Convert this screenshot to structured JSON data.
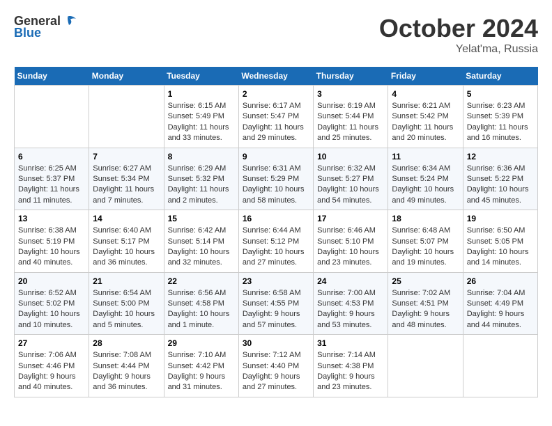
{
  "logo": {
    "general": "General",
    "blue": "Blue"
  },
  "header": {
    "month": "October 2024",
    "location": "Yelat'ma, Russia"
  },
  "weekdays": [
    "Sunday",
    "Monday",
    "Tuesday",
    "Wednesday",
    "Thursday",
    "Friday",
    "Saturday"
  ],
  "weeks": [
    [
      {
        "day": "",
        "info": ""
      },
      {
        "day": "",
        "info": ""
      },
      {
        "day": "1",
        "info": "Sunrise: 6:15 AM\nSunset: 5:49 PM\nDaylight: 11 hours and 33 minutes."
      },
      {
        "day": "2",
        "info": "Sunrise: 6:17 AM\nSunset: 5:47 PM\nDaylight: 11 hours and 29 minutes."
      },
      {
        "day": "3",
        "info": "Sunrise: 6:19 AM\nSunset: 5:44 PM\nDaylight: 11 hours and 25 minutes."
      },
      {
        "day": "4",
        "info": "Sunrise: 6:21 AM\nSunset: 5:42 PM\nDaylight: 11 hours and 20 minutes."
      },
      {
        "day": "5",
        "info": "Sunrise: 6:23 AM\nSunset: 5:39 PM\nDaylight: 11 hours and 16 minutes."
      }
    ],
    [
      {
        "day": "6",
        "info": "Sunrise: 6:25 AM\nSunset: 5:37 PM\nDaylight: 11 hours and 11 minutes."
      },
      {
        "day": "7",
        "info": "Sunrise: 6:27 AM\nSunset: 5:34 PM\nDaylight: 11 hours and 7 minutes."
      },
      {
        "day": "8",
        "info": "Sunrise: 6:29 AM\nSunset: 5:32 PM\nDaylight: 11 hours and 2 minutes."
      },
      {
        "day": "9",
        "info": "Sunrise: 6:31 AM\nSunset: 5:29 PM\nDaylight: 10 hours and 58 minutes."
      },
      {
        "day": "10",
        "info": "Sunrise: 6:32 AM\nSunset: 5:27 PM\nDaylight: 10 hours and 54 minutes."
      },
      {
        "day": "11",
        "info": "Sunrise: 6:34 AM\nSunset: 5:24 PM\nDaylight: 10 hours and 49 minutes."
      },
      {
        "day": "12",
        "info": "Sunrise: 6:36 AM\nSunset: 5:22 PM\nDaylight: 10 hours and 45 minutes."
      }
    ],
    [
      {
        "day": "13",
        "info": "Sunrise: 6:38 AM\nSunset: 5:19 PM\nDaylight: 10 hours and 40 minutes."
      },
      {
        "day": "14",
        "info": "Sunrise: 6:40 AM\nSunset: 5:17 PM\nDaylight: 10 hours and 36 minutes."
      },
      {
        "day": "15",
        "info": "Sunrise: 6:42 AM\nSunset: 5:14 PM\nDaylight: 10 hours and 32 minutes."
      },
      {
        "day": "16",
        "info": "Sunrise: 6:44 AM\nSunset: 5:12 PM\nDaylight: 10 hours and 27 minutes."
      },
      {
        "day": "17",
        "info": "Sunrise: 6:46 AM\nSunset: 5:10 PM\nDaylight: 10 hours and 23 minutes."
      },
      {
        "day": "18",
        "info": "Sunrise: 6:48 AM\nSunset: 5:07 PM\nDaylight: 10 hours and 19 minutes."
      },
      {
        "day": "19",
        "info": "Sunrise: 6:50 AM\nSunset: 5:05 PM\nDaylight: 10 hours and 14 minutes."
      }
    ],
    [
      {
        "day": "20",
        "info": "Sunrise: 6:52 AM\nSunset: 5:02 PM\nDaylight: 10 hours and 10 minutes."
      },
      {
        "day": "21",
        "info": "Sunrise: 6:54 AM\nSunset: 5:00 PM\nDaylight: 10 hours and 5 minutes."
      },
      {
        "day": "22",
        "info": "Sunrise: 6:56 AM\nSunset: 4:58 PM\nDaylight: 10 hours and 1 minute."
      },
      {
        "day": "23",
        "info": "Sunrise: 6:58 AM\nSunset: 4:55 PM\nDaylight: 9 hours and 57 minutes."
      },
      {
        "day": "24",
        "info": "Sunrise: 7:00 AM\nSunset: 4:53 PM\nDaylight: 9 hours and 53 minutes."
      },
      {
        "day": "25",
        "info": "Sunrise: 7:02 AM\nSunset: 4:51 PM\nDaylight: 9 hours and 48 minutes."
      },
      {
        "day": "26",
        "info": "Sunrise: 7:04 AM\nSunset: 4:49 PM\nDaylight: 9 hours and 44 minutes."
      }
    ],
    [
      {
        "day": "27",
        "info": "Sunrise: 7:06 AM\nSunset: 4:46 PM\nDaylight: 9 hours and 40 minutes."
      },
      {
        "day": "28",
        "info": "Sunrise: 7:08 AM\nSunset: 4:44 PM\nDaylight: 9 hours and 36 minutes."
      },
      {
        "day": "29",
        "info": "Sunrise: 7:10 AM\nSunset: 4:42 PM\nDaylight: 9 hours and 31 minutes."
      },
      {
        "day": "30",
        "info": "Sunrise: 7:12 AM\nSunset: 4:40 PM\nDaylight: 9 hours and 27 minutes."
      },
      {
        "day": "31",
        "info": "Sunrise: 7:14 AM\nSunset: 4:38 PM\nDaylight: 9 hours and 23 minutes."
      },
      {
        "day": "",
        "info": ""
      },
      {
        "day": "",
        "info": ""
      }
    ]
  ]
}
